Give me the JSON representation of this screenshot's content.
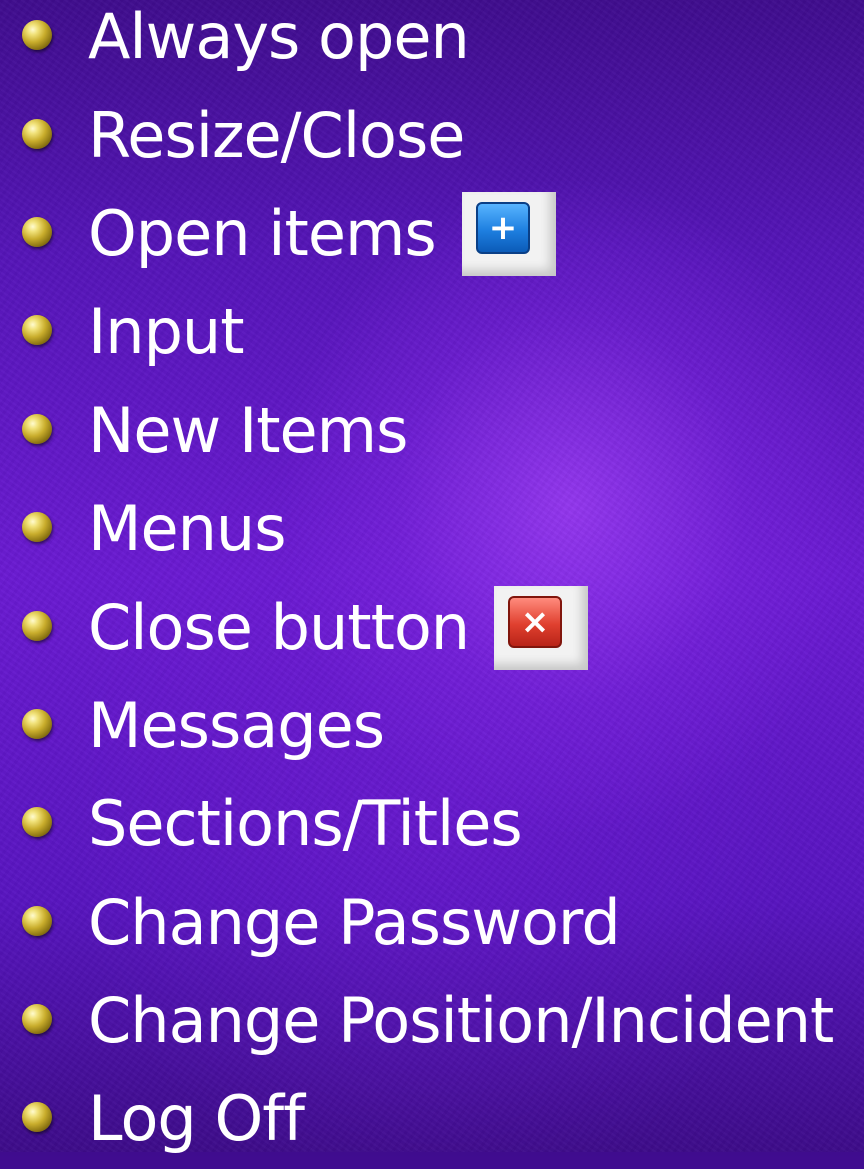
{
  "bullets": [
    {
      "label": "Always open"
    },
    {
      "label": "Resize/Close"
    },
    {
      "label": "Open items"
    },
    {
      "label": "Input"
    },
    {
      "label": "New Items"
    },
    {
      "label": "Menus"
    },
    {
      "label": "Close button"
    },
    {
      "label": "Messages"
    },
    {
      "label": "Sections/Titles"
    },
    {
      "label": "Change Password"
    },
    {
      "label": "Change Position/Incident"
    },
    {
      "label": "Log Off"
    }
  ],
  "icons": {
    "bullet": "gold-sphere-icon",
    "open_items": "plus-icon",
    "close_button": "close-icon"
  },
  "colors": {
    "background": "#5a16c4",
    "text": "#ffffff",
    "bullet": "#c9ad2c",
    "plus_icon": "#1e7fe0",
    "close_icon": "#e0402f"
  }
}
